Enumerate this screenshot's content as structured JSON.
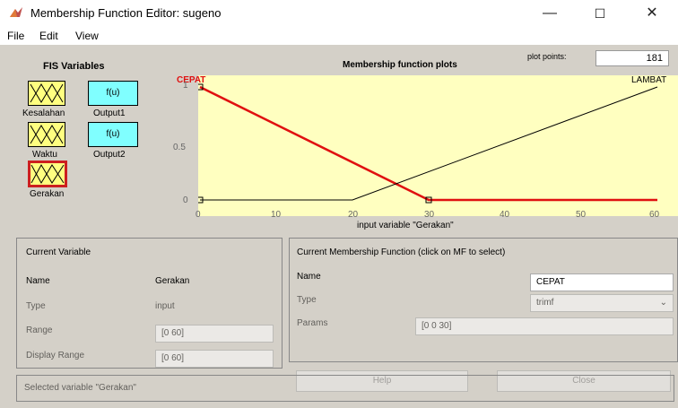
{
  "window": {
    "title": "Membership Function Editor: sugeno",
    "minimize": "—",
    "maximize": "☐",
    "close": "✕"
  },
  "menu": [
    "File",
    "Edit",
    "View"
  ],
  "fis": {
    "title": "FIS Variables",
    "inputs": [
      "Kesalahan",
      "Waktu",
      "Gerakan"
    ],
    "outputs": [
      {
        "label": "Output1",
        "func": "f(u)"
      },
      {
        "label": "Output2",
        "func": "f(u)"
      }
    ],
    "selected": "Gerakan"
  },
  "plot": {
    "title": "Membership function plots",
    "plot_points_label": "plot points:",
    "plot_points": "181",
    "xlabel": "input variable \"Gerakan\"",
    "mf_labels": [
      "CEPAT",
      "LAMBAT"
    ]
  },
  "chart_data": {
    "type": "line",
    "xlim": [
      0,
      60
    ],
    "ylim": [
      0,
      1
    ],
    "xticks": [
      "0",
      "10",
      "20",
      "30",
      "40",
      "50",
      "60"
    ],
    "yticks": [
      "0",
      "0.5",
      "1"
    ],
    "series": [
      {
        "name": "CEPAT",
        "color": "#e01010",
        "x": [
          0,
          30,
          60
        ],
        "y": [
          1,
          0,
          0
        ]
      },
      {
        "name": "LAMBAT",
        "color": "#000000",
        "x": [
          0,
          20,
          60
        ],
        "y": [
          0,
          0,
          1
        ]
      }
    ]
  },
  "current_variable": {
    "title": "Current Variable",
    "name_label": "Name",
    "name": "Gerakan",
    "type_label": "Type",
    "type": "input",
    "range_label": "Range",
    "range": "[0 60]",
    "display_range_label": "Display Range",
    "display_range": "[0 60]"
  },
  "current_mf": {
    "title": "Current Membership Function (click on MF to select)",
    "name_label": "Name",
    "name": "CEPAT",
    "type_label": "Type",
    "type": "trimf",
    "params_label": "Params",
    "params": "[0 0 30]"
  },
  "buttons": {
    "help": "Help",
    "close": "Close"
  },
  "status": "Selected variable \"Gerakan\"",
  "colors": {
    "panel_bg": "#d4d0c8",
    "plot_bg": "#ffffc0",
    "input_block": "#ffff80",
    "output_block": "#80ffff",
    "selected_border": "#cc1f1f"
  }
}
